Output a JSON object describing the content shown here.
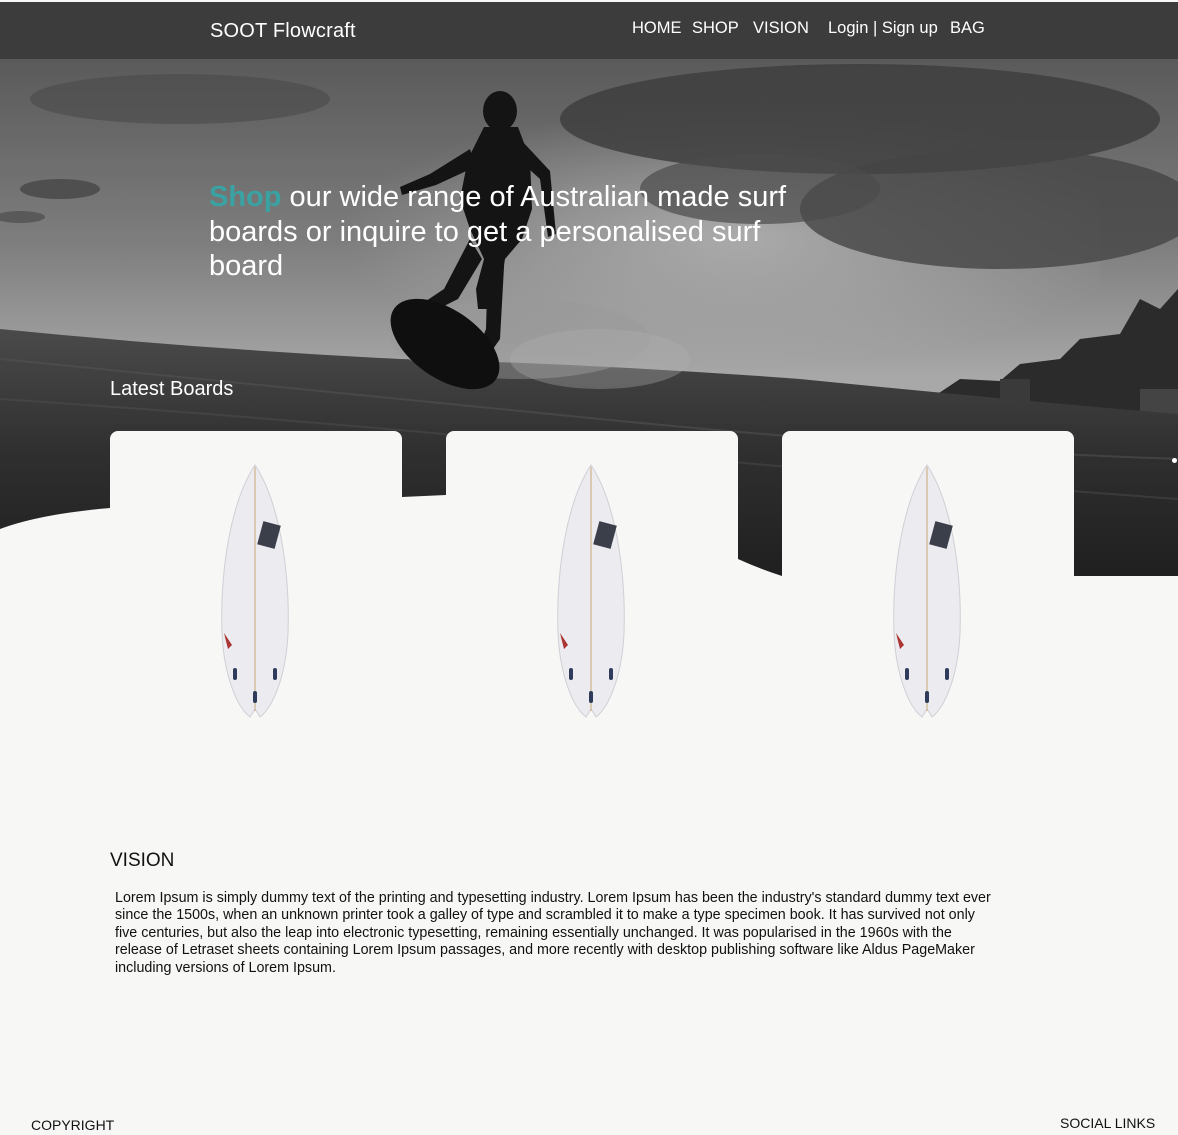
{
  "nav": {
    "brand": "SOOT Flowcraft",
    "links": [
      "HOME",
      "SHOP",
      "VISION",
      "Login | Sign up",
      "BAG"
    ]
  },
  "hero": {
    "headline_accent": "Shop",
    "headline_rest": " our wide range of Australian made surf boards or inquire to get a personalised surf board"
  },
  "latest": {
    "title": "Latest Boards"
  },
  "vision": {
    "title": "VISION",
    "text": "Lorem Ipsum is simply dummy text of the printing and typesetting industry. Lorem Ipsum has been the industry's standard dummy text ever since the 1500s, when an unknown printer took a galley of type and scrambled it to make a type specimen book. It has survived not only five centuries, but also the leap into electronic typesetting, remaining essentially unchanged. It was popularised in the 1960s with the release of Letraset sheets containing Lorem Ipsum passages, and more recently with desktop publishing software like Aldus PageMaker including versions of Lorem Ipsum."
  },
  "footer": {
    "copyright": "COPYRIGHT",
    "social": "SOCIAL LINKS"
  },
  "colors": {
    "accent": "#3aa2a2",
    "navbar": "#3c3c3c",
    "background": "#f7f7f5"
  }
}
